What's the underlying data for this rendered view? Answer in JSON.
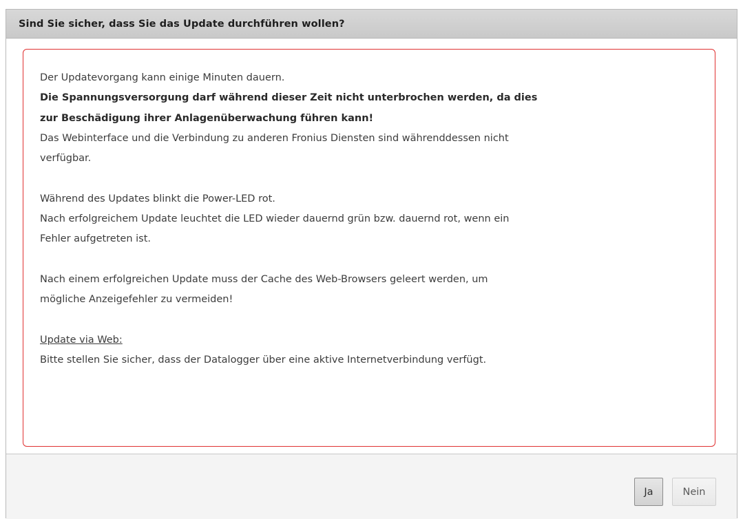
{
  "dialog": {
    "title": "Sind Sie sicher, dass Sie das Update durchführen wollen?",
    "message": {
      "intro": "Der Updatevorgang kann einige Minuten dauern.",
      "warning_line1": "Die Spannungsversorgung darf während dieser Zeit nicht unterbrochen werden, da dies",
      "warning_line2": "zur Beschädigung ihrer Anlagenüberwachung führen kann!",
      "unavailable_line1": "Das Webinterface und die Verbindung zu anderen Fronius Diensten sind währenddessen nicht",
      "unavailable_line2": "verfügbar.",
      "led_blink": "Während des Updates blinkt die Power-LED rot.",
      "led_after_line1": "Nach erfolgreichem Update leuchtet die LED wieder dauernd grün bzw. dauernd rot, wenn ein",
      "led_after_line2": "Fehler aufgetreten ist.",
      "cache_line1": "Nach einem erfolgreichen Update muss der Cache des Web-Browsers geleert werden, um",
      "cache_line2": "mögliche Anzeigefehler zu vermeiden!",
      "web_heading": "Update via Web:",
      "web_text": "Bitte stellen Sie sicher, dass der Datalogger über eine aktive Internetverbindung verfügt."
    },
    "buttons": {
      "yes_label": "Ja",
      "no_label": "Nein"
    },
    "colors": {
      "warning_border": "#e03030",
      "title_bar": "#cfcfcf"
    }
  }
}
